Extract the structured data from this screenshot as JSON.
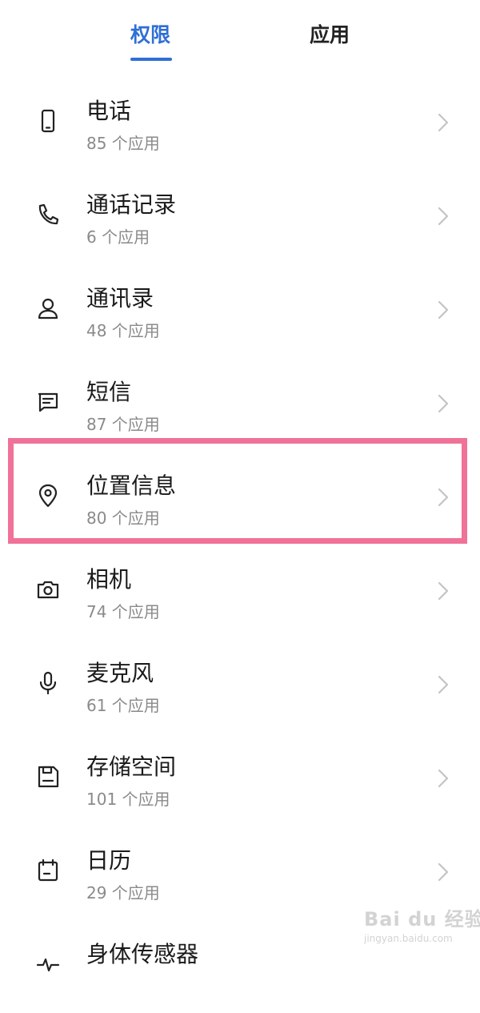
{
  "tabs": [
    {
      "label": "权限",
      "active": true
    },
    {
      "label": "应用",
      "active": false
    }
  ],
  "colors": {
    "accent": "#2f6fd6",
    "highlight": "#f07298"
  },
  "items": [
    {
      "title": "电话",
      "subtitle": "85 个应用",
      "icon": "phone-device-icon"
    },
    {
      "title": "通话记录",
      "subtitle": "6 个应用",
      "icon": "call-log-icon"
    },
    {
      "title": "通讯录",
      "subtitle": "48 个应用",
      "icon": "contacts-icon"
    },
    {
      "title": "短信",
      "subtitle": "87 个应用",
      "icon": "message-icon"
    },
    {
      "title": "位置信息",
      "subtitle": "80 个应用",
      "icon": "location-pin-icon",
      "highlighted": true
    },
    {
      "title": "相机",
      "subtitle": "74 个应用",
      "icon": "camera-icon"
    },
    {
      "title": "麦克风",
      "subtitle": "61 个应用",
      "icon": "microphone-icon"
    },
    {
      "title": "存储空间",
      "subtitle": "101 个应用",
      "icon": "storage-icon"
    },
    {
      "title": "日历",
      "subtitle": "29 个应用",
      "icon": "calendar-icon"
    },
    {
      "title": "身体传感器",
      "subtitle": "",
      "icon": "body-sensor-icon"
    }
  ],
  "watermark": {
    "logo": "Bai du 经验",
    "url": "jingyan.baidu.com"
  }
}
